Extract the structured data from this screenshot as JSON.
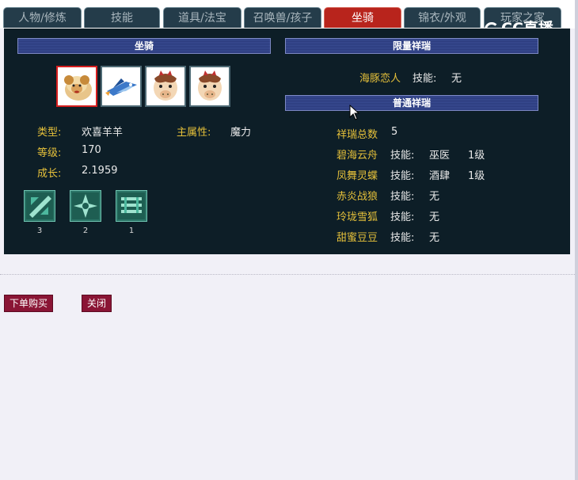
{
  "tabs": [
    {
      "label": "人物/修炼",
      "active": false
    },
    {
      "label": "技能",
      "active": false
    },
    {
      "label": "道具/法宝",
      "active": false
    },
    {
      "label": "召唤兽/孩子",
      "active": false
    },
    {
      "label": "坐骑",
      "active": true
    },
    {
      "label": "锦衣/外观",
      "active": false
    },
    {
      "label": "玩家之家",
      "active": false
    }
  ],
  "watermark": "CC直播",
  "mount_panel": {
    "header": "坐骑",
    "slots": [
      "sheep-mount-icon",
      "blue-jet-mount-icon",
      "horse-mount-icon",
      "horse-mount-icon"
    ],
    "type_label": "类型:",
    "type_value": "欢喜羊羊",
    "main_attr_label": "主属性:",
    "main_attr_value": "魔力",
    "level_label": "等级:",
    "level_value": "170",
    "growth_label": "成长:",
    "growth_value": "2.1959",
    "skills": [
      {
        "icon": "mount-skill-icon",
        "count": "3"
      },
      {
        "icon": "mount-skill-icon",
        "count": "2"
      },
      {
        "icon": "mount-skill-icon",
        "count": "1"
      }
    ]
  },
  "limited_panel": {
    "header": "限量祥瑞",
    "items": [
      {
        "name": "海豚恋人",
        "skill_label": "技能:",
        "skill": "无",
        "level": ""
      }
    ]
  },
  "normal_panel": {
    "header": "普通祥瑞",
    "total_label": "祥瑞总数",
    "total_value": "5",
    "items": [
      {
        "name": "碧海云舟",
        "skill_label": "技能:",
        "skill": "巫医",
        "level": "1级"
      },
      {
        "name": "凤舞灵蝶",
        "skill_label": "技能:",
        "skill": "酒肆",
        "level": "1级"
      },
      {
        "name": "赤炎战狼",
        "skill_label": "技能:",
        "skill": "无",
        "level": ""
      },
      {
        "name": "玲珑雪狐",
        "skill_label": "技能:",
        "skill": "无",
        "level": ""
      },
      {
        "name": "甜蜜豆豆",
        "skill_label": "技能:",
        "skill": "无",
        "level": ""
      }
    ]
  },
  "buttons": {
    "buy": "下单购买",
    "close": "关闭"
  },
  "colors": {
    "panel_bg": "#0d1e27",
    "label_gold": "#e5c03a",
    "active_tab": "#b8241c",
    "button": "#8a1535",
    "selected_slot_border": "#d61e1e"
  }
}
